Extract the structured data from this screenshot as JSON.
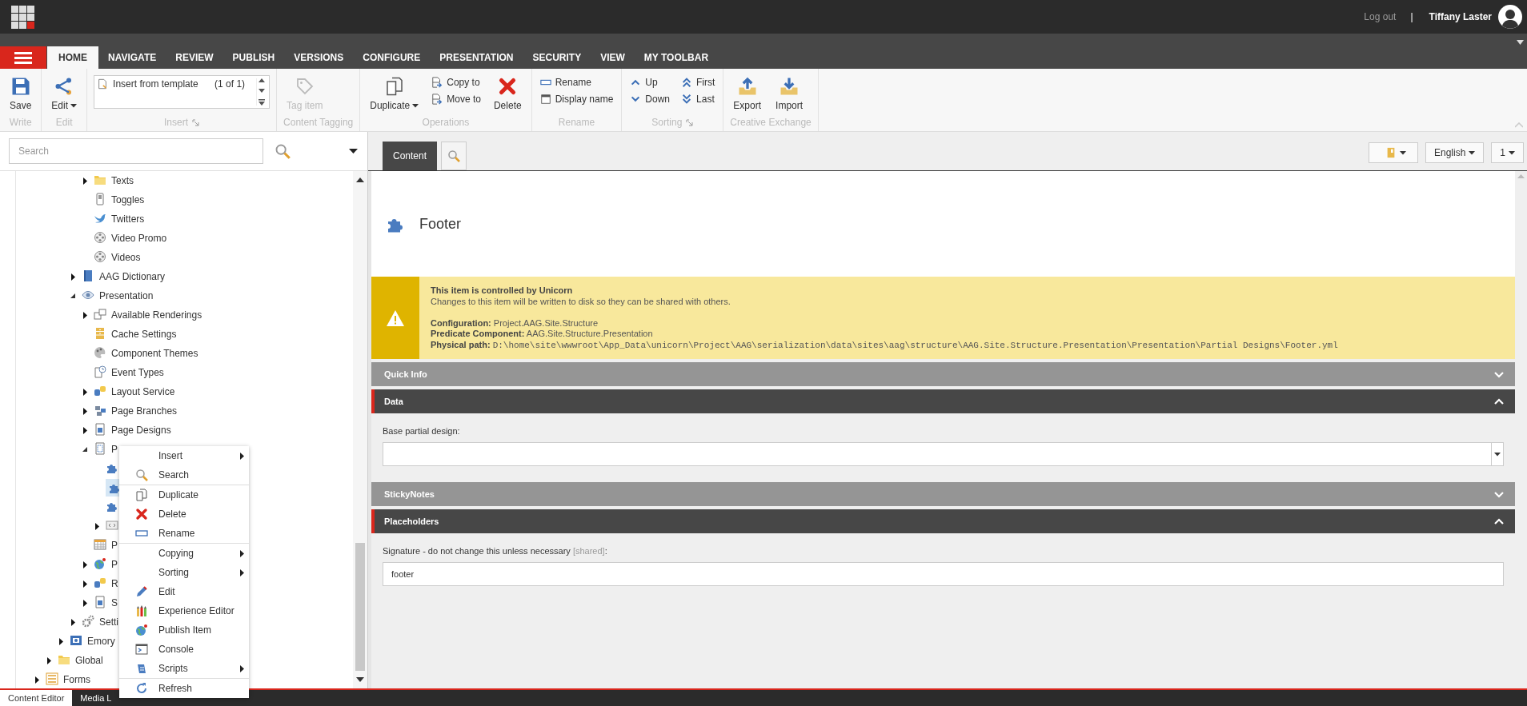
{
  "top_bar": {
    "logout": "Log out",
    "separator": "|",
    "user": "Tiffany Laster"
  },
  "ribbon": {
    "tabs": [
      {
        "label": "HOME",
        "selected": true
      },
      {
        "label": "NAVIGATE",
        "selected": false
      },
      {
        "label": "REVIEW",
        "selected": false
      },
      {
        "label": "PUBLISH",
        "selected": false
      },
      {
        "label": "VERSIONS",
        "selected": false
      },
      {
        "label": "CONFIGURE",
        "selected": false
      },
      {
        "label": "PRESENTATION",
        "selected": false
      },
      {
        "label": "SECURITY",
        "selected": false
      },
      {
        "label": "VIEW",
        "selected": false
      },
      {
        "label": "MY TOOLBAR",
        "selected": false
      }
    ],
    "groups": [
      {
        "label": "Write",
        "launcher": false,
        "buttons": [
          {
            "kind": "save",
            "label": "Save",
            "dropdown": false,
            "disabled": false
          }
        ]
      },
      {
        "label": "Edit",
        "launcher": false,
        "buttons": [
          {
            "kind": "edit",
            "label": "Edit",
            "dropdown": true,
            "disabled": false
          }
        ]
      },
      {
        "label": "Insert",
        "launcher": true,
        "buttons": [
          {
            "kind": "insert",
            "label": "Insert from template",
            "count": "(1 of 1)",
            "disabled": false
          }
        ]
      },
      {
        "label": "Content Tagging",
        "launcher": false,
        "buttons": [
          {
            "kind": "tag",
            "label": "Tag item",
            "dropdown": false,
            "disabled": true
          }
        ]
      },
      {
        "label": "Operations",
        "launcher": false,
        "buttons": [
          {
            "kind": "duplicate",
            "label": "Duplicate",
            "dropdown": true,
            "disabled": false
          },
          {
            "kind": "copyto",
            "label": "Copy to",
            "disabled": false
          },
          {
            "kind": "moveto",
            "label": "Move to",
            "disabled": false
          },
          {
            "kind": "delete",
            "label": "Delete",
            "dropdown": false,
            "disabled": false
          }
        ]
      },
      {
        "label": "Rename",
        "launcher": false,
        "buttons": [
          {
            "kind": "rename",
            "label": "Rename",
            "disabled": false
          },
          {
            "kind": "displayname",
            "label": "Display name",
            "disabled": false
          }
        ]
      },
      {
        "label": "Sorting",
        "launcher": true,
        "buttons": [
          {
            "kind": "up",
            "label": "Up",
            "disabled": false
          },
          {
            "kind": "down",
            "label": "Down",
            "disabled": false
          },
          {
            "kind": "first",
            "label": "First",
            "disabled": false
          },
          {
            "kind": "last",
            "label": "Last",
            "disabled": false
          }
        ]
      },
      {
        "label": "Creative Exchange",
        "launcher": false,
        "buttons": [
          {
            "kind": "export",
            "label": "Export",
            "dropdown": false,
            "disabled": false
          },
          {
            "kind": "import",
            "label": "Import",
            "dropdown": false,
            "disabled": false
          }
        ]
      }
    ]
  },
  "tree_panel": {
    "search": {
      "placeholder": "Search"
    },
    "items": [
      {
        "children": [
          {
            "children": [
              {
                "children": [
                  {
                    "children": [
                      {
                        "label": "Texts",
                        "kind": "folder",
                        "expanded": false,
                        "selected": false
                      },
                      {
                        "label": "Toggles",
                        "kind": "toggles",
                        "selected": false
                      },
                      {
                        "label": "Twitters",
                        "kind": "bird",
                        "selected": false
                      },
                      {
                        "label": "Video Promo",
                        "kind": "film",
                        "selected": false
                      },
                      {
                        "label": "Videos",
                        "kind": "film",
                        "selected": false
                      }
                    ]
                  },
                  {
                    "label": "AAG Dictionary",
                    "kind": "book",
                    "expanded": false,
                    "selected": false
                  },
                  {
                    "label": "Presentation",
                    "kind": "eye",
                    "expanded": true,
                    "selected": false,
                    "children": [
                      {
                        "label": "Available Renderings",
                        "kind": "windows",
                        "expanded": false,
                        "selected": false
                      },
                      {
                        "label": "Cache Settings",
                        "kind": "cabinet",
                        "selected": false
                      },
                      {
                        "label": "Component Themes",
                        "kind": "palette",
                        "selected": false
                      },
                      {
                        "label": "Event Types",
                        "kind": "event",
                        "selected": false
                      },
                      {
                        "label": "Layout Service",
                        "kind": "layout",
                        "expanded": false,
                        "selected": false
                      },
                      {
                        "label": "Page Branches",
                        "kind": "branches",
                        "expanded": false,
                        "selected": false
                      },
                      {
                        "label": "Page Designs",
                        "kind": "pagedesign",
                        "expanded": false,
                        "selected": false
                      },
                      {
                        "label": "P",
                        "kind": "partial",
                        "expanded": true,
                        "selected": false,
                        "children": [
                          {
                            "kind": "puzzle",
                            "selected": false
                          },
                          {
                            "kind": "puzzle",
                            "selected": true
                          },
                          {
                            "kind": "puzzle",
                            "selected": false
                          },
                          {
                            "kind": "code",
                            "expanded": false,
                            "selected": false
                          }
                        ]
                      },
                      {
                        "label": "P",
                        "kind": "table",
                        "selected": false
                      },
                      {
                        "label": "P",
                        "kind": "globe",
                        "expanded": false,
                        "selected": false
                      },
                      {
                        "label": "R",
                        "kind": "layout",
                        "expanded": false,
                        "selected": false
                      },
                      {
                        "label": "S",
                        "kind": "pagedesign",
                        "expanded": false,
                        "selected": false
                      }
                    ]
                  },
                  {
                    "label": "Setti",
                    "kind": "gear",
                    "expanded": false,
                    "selected": false
                  }
                ]
              },
              {
                "label": "Emory",
                "kind": "card",
                "expanded": false,
                "selected": false
              }
            ]
          },
          {
            "label": "Global",
            "kind": "folder",
            "expanded": false,
            "selected": false
          }
        ]
      },
      {
        "label": "Forms",
        "kind": "form",
        "expanded": false,
        "selected": false
      }
    ]
  },
  "editor": {
    "tabs": [
      {
        "kind": "text",
        "label": "Content",
        "selected": true
      },
      {
        "kind": "search",
        "selected": false
      }
    ],
    "tools": [
      {
        "kind": "notebook"
      },
      {
        "kind": "text",
        "label": "English"
      },
      {
        "kind": "text",
        "label": "1"
      }
    ],
    "item": {
      "title": "Footer"
    },
    "notice": {
      "title": "This item is controlled by Unicorn",
      "message": "Changes to this item will be written to disk so they can be shared with others.",
      "details": [
        {
          "label": "Configuration:",
          "value": "Project.AAG.Site.Structure",
          "kind": "text"
        },
        {
          "label": "Predicate Component:",
          "value": "AAG.Site.Structure.Presentation",
          "kind": "text"
        },
        {
          "label": "Physical path:",
          "value": "D:\\home\\site\\wwwroot\\App_Data\\unicorn\\Project\\AAG\\serialization\\data\\sites\\aag\\structure\\AAG.Site.Structure.Presentation\\Presentation\\Partial Designs\\Footer.yml",
          "kind": "code"
        }
      ]
    },
    "sections": [
      {
        "title": "Quick Info",
        "expanded": false
      },
      {
        "title": "Data",
        "expanded": true,
        "fields": [
          {
            "kind": "dropdown",
            "label": "Base partial design:"
          }
        ]
      },
      {
        "title": "StickyNotes",
        "expanded": false
      },
      {
        "title": "Placeholders",
        "expanded": true,
        "fields": [
          {
            "kind": "text",
            "label": "Signature - do not change this unless necessary",
            "note": "[shared]",
            "suffix": ":",
            "value": "footer"
          }
        ]
      }
    ]
  },
  "context_menu": {
    "items": [
      {
        "label": "Insert",
        "kind": "plain",
        "submenu": true,
        "divider": false
      },
      {
        "label": "Search",
        "kind": "search",
        "submenu": false,
        "divider": false
      },
      {
        "label": "Duplicate",
        "kind": "duplicate",
        "submenu": false,
        "divider": true
      },
      {
        "label": "Delete",
        "kind": "delete",
        "submenu": false,
        "divider": false
      },
      {
        "label": "Rename",
        "kind": "rename",
        "submenu": false,
        "divider": false
      },
      {
        "label": "Copying",
        "kind": "plain",
        "submenu": true,
        "divider": true
      },
      {
        "label": "Sorting",
        "kind": "plain",
        "submenu": true,
        "divider": false
      },
      {
        "label": "Edit",
        "kind": "edit",
        "submenu": false,
        "divider": false
      },
      {
        "label": "Experience Editor",
        "kind": "experience",
        "submenu": false,
        "divider": false
      },
      {
        "label": "Publish Item",
        "kind": "publish",
        "submenu": false,
        "divider": false
      },
      {
        "label": "Console",
        "kind": "console",
        "submenu": false,
        "divider": false
      },
      {
        "label": "Scripts",
        "kind": "scripts",
        "submenu": true,
        "divider": false
      },
      {
        "label": "Refresh",
        "kind": "refresh",
        "submenu": false,
        "divider": true
      }
    ]
  },
  "bottom_bar": {
    "tabs": [
      {
        "label": "Content Editor",
        "selected": true
      },
      {
        "label": "Media L",
        "selected": false
      }
    ]
  }
}
